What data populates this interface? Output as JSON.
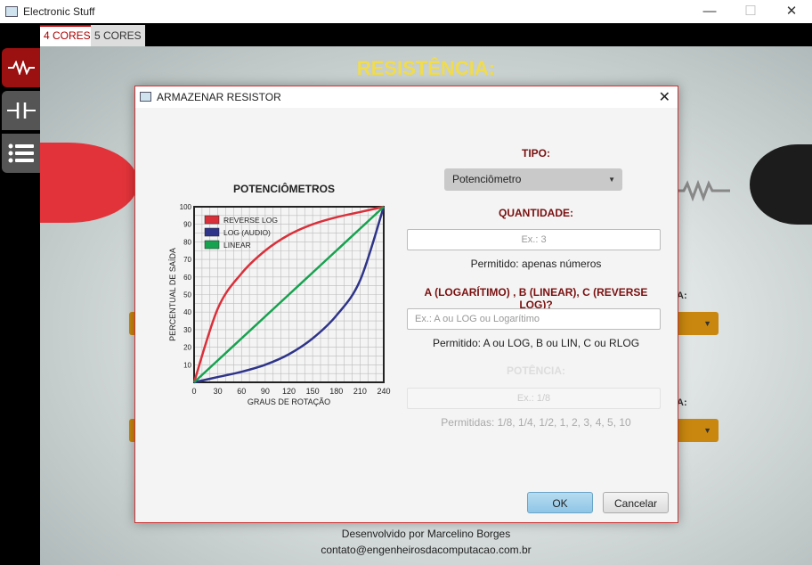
{
  "window": {
    "title": "Electronic Stuff",
    "minimize": "—",
    "maximize": "☐",
    "close": "✕"
  },
  "tabs": [
    {
      "label": "4 CORES",
      "active": true
    },
    {
      "label": "5 CORES",
      "active": false
    }
  ],
  "rail": [
    {
      "icon": "resistor-icon",
      "active": true
    },
    {
      "icon": "capacitor-icon",
      "active": false
    },
    {
      "icon": "list-icon",
      "active": false
    }
  ],
  "background": {
    "title": "RESISTÊNCIA:",
    "label_a": "A:",
    "label_b": "A:",
    "footer_line1": "Desenvolvido por Marcelino Borges",
    "footer_line2": "contato@engenheirosdacomputacao.com.br"
  },
  "dialog": {
    "title": "ARMAZENAR RESISTOR",
    "close": "✕",
    "chart_heading": "POTENCIÔMETROS",
    "tipo_label": "TIPO:",
    "tipo_value": "Potenciômetro",
    "quantidade_label": "QUANTIDADE:",
    "quantidade_placeholder": "Ex.: 3",
    "quantidade_hint": "Permitido: apenas números",
    "abc_label": "A (LOGARÍTIMO) , B (LINEAR), C (REVERSE LOG)?",
    "abc_placeholder": "Ex.: A ou LOG ou Logarítimo",
    "abc_hint": "Permitido: A ou LOG, B ou LIN, C ou RLOG",
    "potencia_label": "POTÊNCIA:",
    "potencia_placeholder": "Ex.: 1/8",
    "potencia_hint": "Permitidas: 1/8, 1/4,  1/2, 1, 2, 3, 4, 5, 10",
    "ok": "OK",
    "cancel": "Cancelar"
  },
  "chart_data": {
    "type": "line",
    "title": "",
    "xlabel": "GRAUS DE ROTAÇÃO",
    "ylabel": "PERCENTUAL DE SAÍDA",
    "xlim": [
      0,
      240
    ],
    "ylim": [
      0,
      100
    ],
    "x_ticks": [
      0,
      30,
      60,
      90,
      120,
      150,
      180,
      210,
      240
    ],
    "y_ticks": [
      10,
      20,
      30,
      40,
      50,
      60,
      70,
      80,
      90,
      100
    ],
    "grid": true,
    "legend_position": "top-left",
    "x": [
      0,
      30,
      60,
      90,
      120,
      150,
      180,
      210,
      240
    ],
    "series": [
      {
        "name": "REVERSE LOG",
        "color": "#d9303a",
        "values": [
          0,
          42,
          62,
          75,
          84,
          90,
          94,
          97,
          100
        ]
      },
      {
        "name": "LOG (AUDIO)",
        "color": "#2e3489",
        "values": [
          0,
          3,
          6,
          10,
          16,
          25,
          38,
          58,
          100
        ]
      },
      {
        "name": "LINEAR",
        "color": "#17a24f",
        "values": [
          0,
          12.5,
          25,
          37.5,
          50,
          62.5,
          75,
          87.5,
          100
        ]
      }
    ]
  }
}
